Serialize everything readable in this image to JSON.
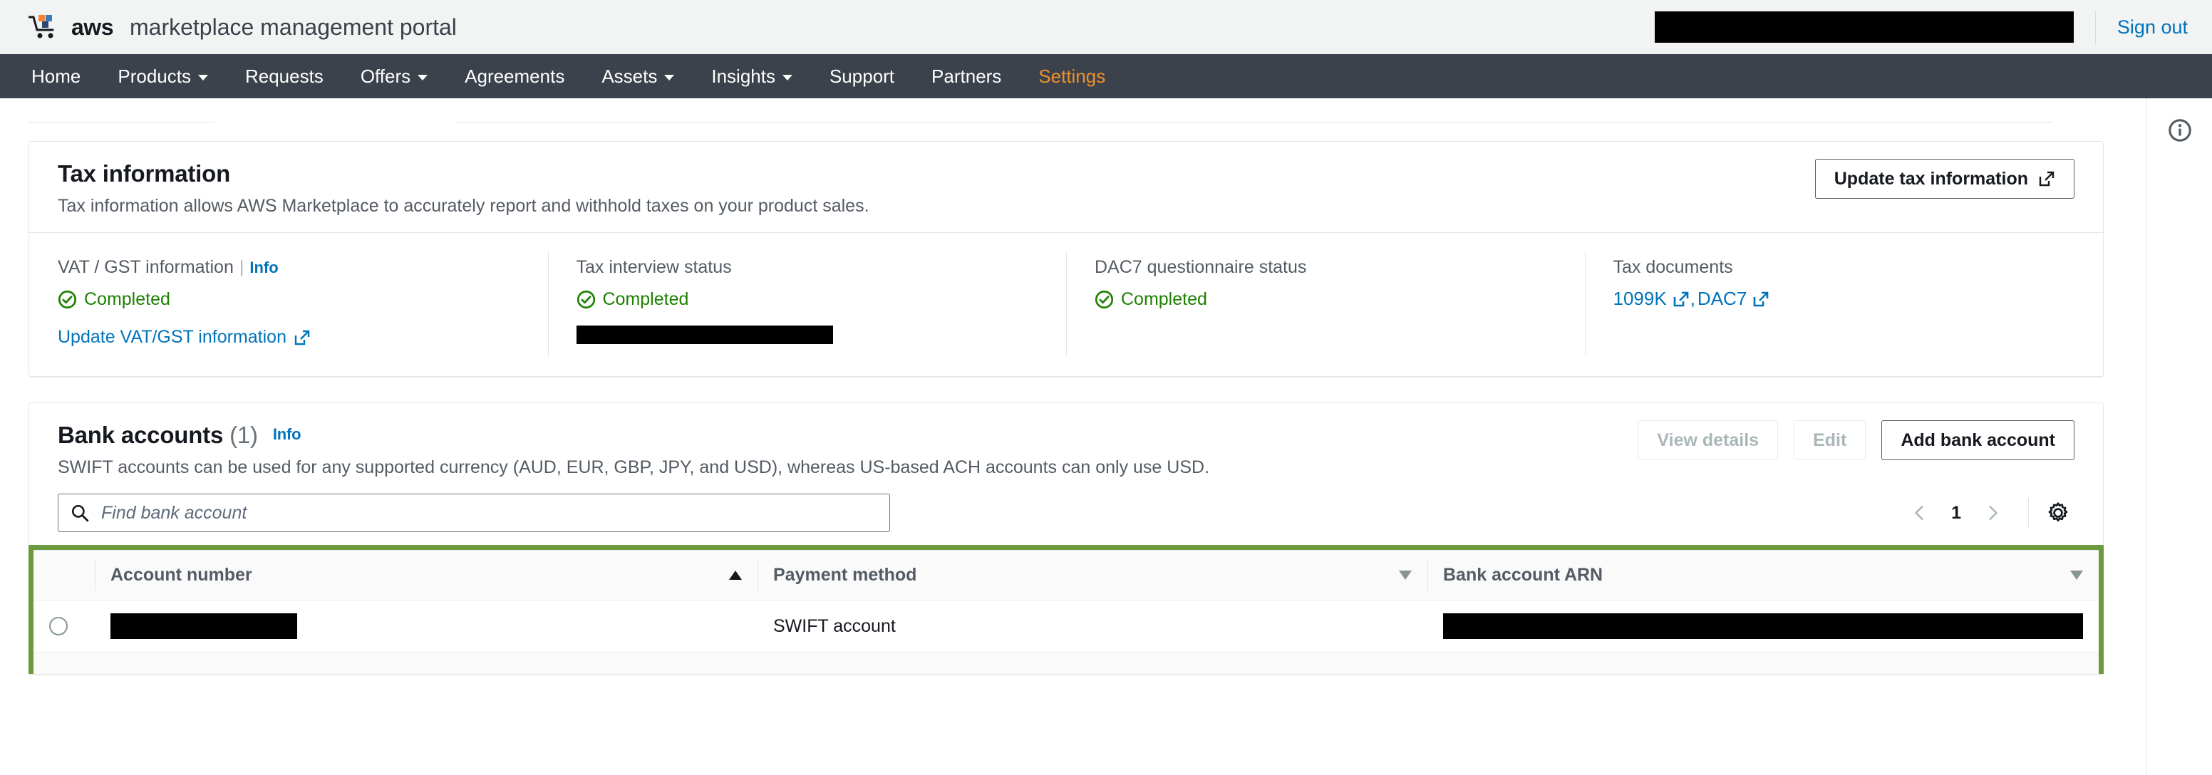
{
  "header": {
    "brand_aws": "aws",
    "brand_rest": "marketplace management portal",
    "account_redacted": true,
    "sign_out": "Sign out"
  },
  "nav": {
    "items": [
      {
        "label": "Home",
        "caret": false,
        "active": false
      },
      {
        "label": "Products",
        "caret": true,
        "active": false
      },
      {
        "label": "Requests",
        "caret": false,
        "active": false
      },
      {
        "label": "Offers",
        "caret": true,
        "active": false
      },
      {
        "label": "Agreements",
        "caret": false,
        "active": false
      },
      {
        "label": "Assets",
        "caret": true,
        "active": false
      },
      {
        "label": "Insights",
        "caret": true,
        "active": false
      },
      {
        "label": "Support",
        "caret": false,
        "active": false
      },
      {
        "label": "Partners",
        "caret": false,
        "active": false
      },
      {
        "label": "Settings",
        "caret": false,
        "active": true
      }
    ]
  },
  "tax_card": {
    "title": "Tax information",
    "description": "Tax information allows AWS Marketplace to accurately report and withhold taxes on your product sales.",
    "update_button": "Update tax information",
    "columns": {
      "vat": {
        "label": "VAT / GST information",
        "info_label": "Info",
        "status": "Completed",
        "link": "Update VAT/GST information"
      },
      "interview": {
        "label": "Tax interview status",
        "status": "Completed",
        "redacted_value": true
      },
      "dac7": {
        "label": "DAC7 questionnaire status",
        "status": "Completed"
      },
      "documents": {
        "label": "Tax documents",
        "links": [
          "1099K",
          "DAC7"
        ],
        "separator": ","
      }
    }
  },
  "bank_card": {
    "title": "Bank accounts",
    "count": "(1)",
    "info_label": "Info",
    "description": "SWIFT accounts can be used for any supported currency (AUD, EUR, GBP, JPY, and USD), whereas US-based ACH accounts can only use USD.",
    "actions": [
      {
        "label": "View details",
        "disabled": true
      },
      {
        "label": "Edit",
        "disabled": true
      },
      {
        "label": "Add bank account",
        "disabled": false
      }
    ],
    "search_placeholder": "Find bank account",
    "search_value": "",
    "pagination": {
      "page": "1",
      "prev_enabled": false,
      "next_enabled": false
    },
    "table": {
      "columns": [
        {
          "label": "Account number",
          "sort": "asc"
        },
        {
          "label": "Payment method",
          "sort": "desc"
        },
        {
          "label": "Bank account ARN",
          "sort": "desc"
        }
      ],
      "rows": [
        {
          "selected": false,
          "account_number_redacted": true,
          "payment_method": "SWIFT account",
          "bank_account_arn_redacted": true
        }
      ]
    }
  },
  "colors": {
    "nav_bg": "#3c424b",
    "active_nav": "#ec912d",
    "link": "#0073bb",
    "success": "#1d8102",
    "highlight": "#6b9a3f"
  }
}
